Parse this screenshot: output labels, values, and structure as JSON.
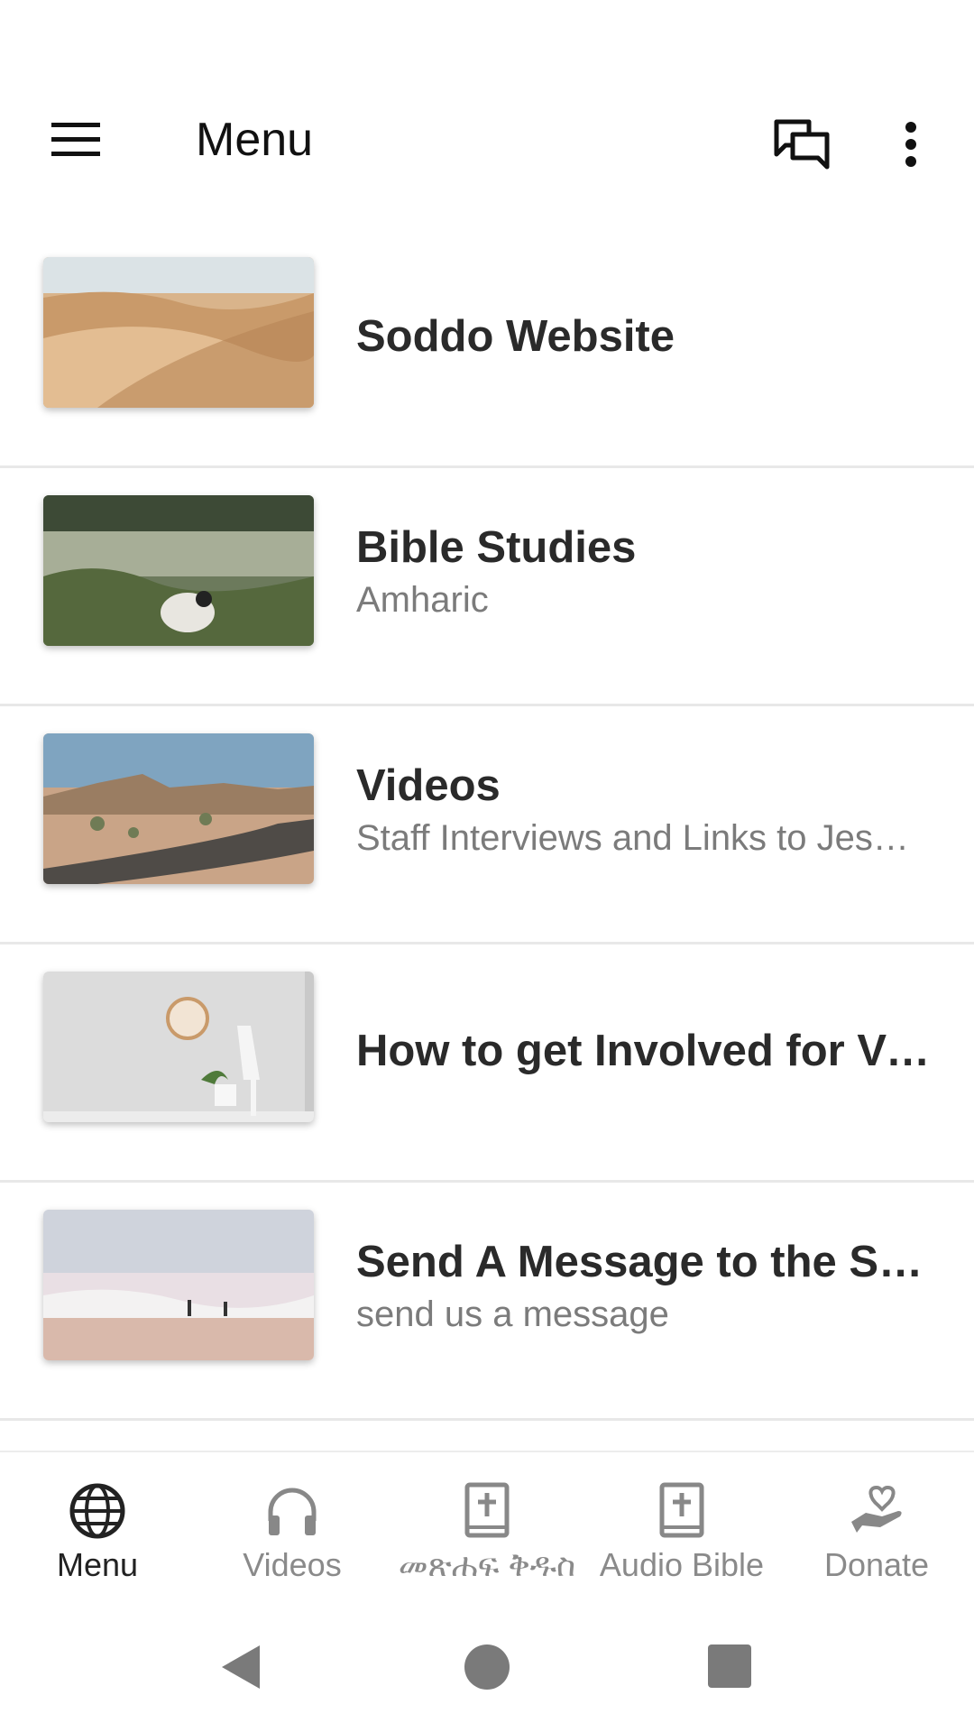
{
  "appbar": {
    "title": "Menu",
    "left_icon": "hamburger-menu-icon",
    "right_icons": [
      "chat-icon",
      "more-vert-icon"
    ]
  },
  "items": [
    {
      "title": "Soddo Website",
      "subtitle": "",
      "thumbnail": "desert-dunes"
    },
    {
      "title": "Bible Studies",
      "subtitle": "Amharic",
      "thumbnail": "lamb-in-field"
    },
    {
      "title": "Videos",
      "subtitle": "Staff Interviews and Links to Jes…",
      "thumbnail": "desert-road"
    },
    {
      "title": "How to get Involved for Vi…",
      "subtitle": "",
      "thumbnail": "clock-wall-plant"
    },
    {
      "title": "Send A Message to the So…",
      "subtitle": "send us a message",
      "thumbnail": "beach-waves"
    }
  ],
  "bottom_nav": [
    {
      "label": "Menu",
      "icon": "globe-icon",
      "active": true
    },
    {
      "label": "Videos",
      "icon": "headphones-icon",
      "active": false
    },
    {
      "label": "መጽሐፍ ቅዱስ",
      "icon": "bible-icon",
      "active": false
    },
    {
      "label": "Audio Bible",
      "icon": "bible-icon",
      "active": false
    },
    {
      "label": "Donate",
      "icon": "donate-hand-heart-icon",
      "active": false
    }
  ],
  "colors": {
    "active": "#222222",
    "inactive": "#8a8a8a",
    "divider": "#e8e8e8"
  }
}
